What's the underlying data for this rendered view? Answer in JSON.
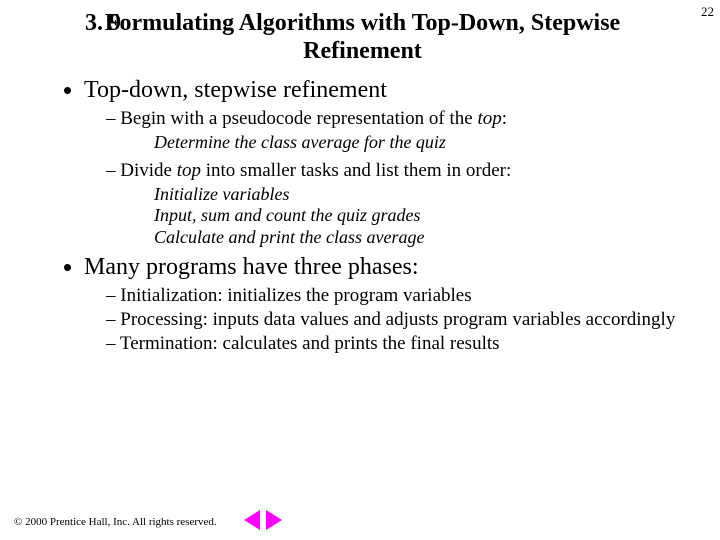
{
  "page_number": "22",
  "title_number": "3. 9",
  "title_text": "Formulating Algorithms with Top-Down, Stepwise Refinement",
  "bullets": {
    "b1a": "Top-down, stepwise refinement",
    "b1a_s1_pre": "Begin with a pseudocode representation of the ",
    "b1a_s1_em": "top",
    "b1a_s1_post": ":",
    "code1": "Determine the class average for the quiz",
    "b1a_s2_pre": "Divide ",
    "b1a_s2_em": "top",
    "b1a_s2_post": " into smaller tasks and list them in order:",
    "code2_l1": "Initialize variables",
    "code2_l2": "Input, sum and count the quiz grades",
    "code2_l3": "Calculate and print the class average",
    "b1b": "Many programs have three phases:",
    "b1b_s1": "Initialization: initializes the program variables",
    "b1b_s2": "Processing: inputs data values and adjusts program variables accordingly",
    "b1b_s3": "Termination: calculates and prints the final results"
  },
  "footer": "© 2000 Prentice Hall, Inc. All rights reserved."
}
